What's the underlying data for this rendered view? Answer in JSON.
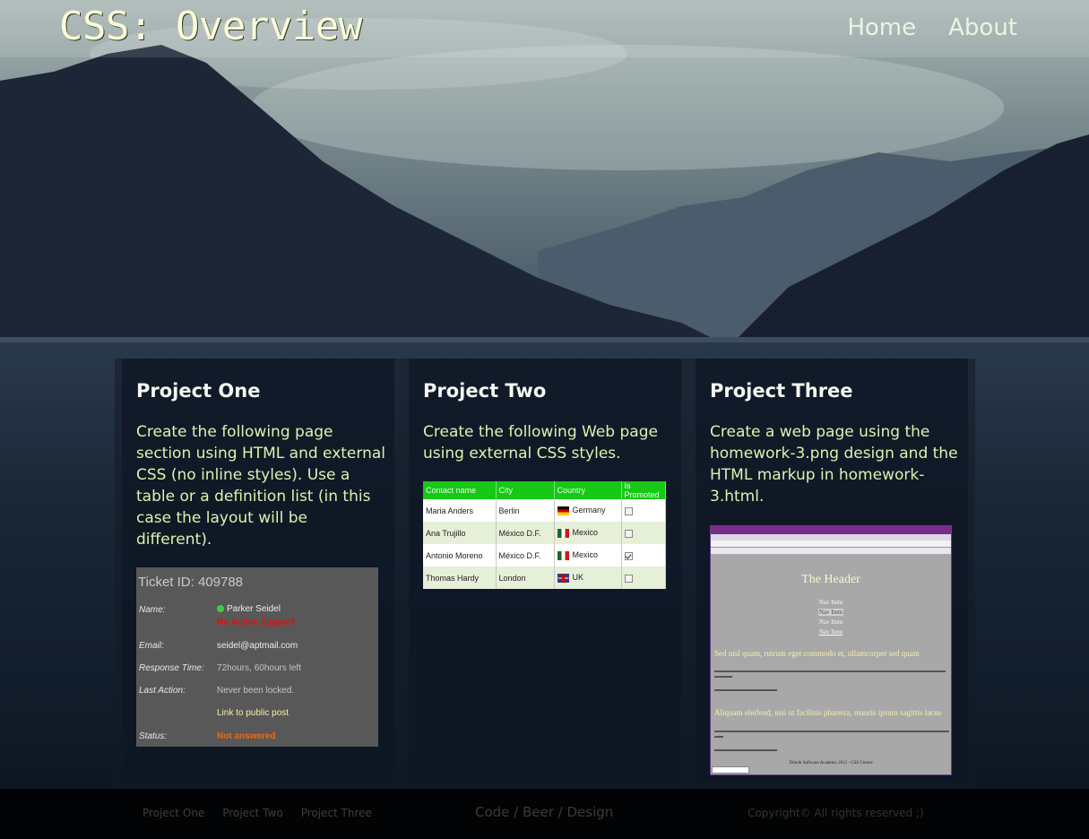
{
  "header": {
    "title": "CSS: Overview",
    "nav": [
      "Home",
      "About"
    ]
  },
  "projects": [
    {
      "title": "Project One",
      "description": "Create the following page section using HTML and external CSS (no inline styles). Use a table or a definition list (in this case the layout will be different)."
    },
    {
      "title": "Project Two",
      "description": "Create the following Web page using external CSS styles."
    },
    {
      "title": "Project Three",
      "description": "Create a web page using the homework-3.png design and the HTML markup in homework-3.html."
    }
  ],
  "ticket": {
    "id_text": "Ticket ID: 409788",
    "name_label": "Name:",
    "name_value": "Parker Seidel",
    "support_status": "No Active Support",
    "email_label": "Email:",
    "email_value": "seidel@aptmail.com",
    "response_label": "Response Time:",
    "response_value": "72hours, 60hours left",
    "last_action_label": "Last Action:",
    "last_action_value": "Never been locked.",
    "post_link": "Link to public post",
    "status_label": "Status:",
    "status_value": "Not answered"
  },
  "contacts_table": {
    "headers": [
      "Contact name",
      "City",
      "Country",
      "Is Promoted"
    ],
    "rows": [
      {
        "name": "Maria Anders",
        "city": "Berlin",
        "country": "Germany",
        "flag": "de",
        "promoted": false
      },
      {
        "name": "Ana Trujillo",
        "city": "México D.F.",
        "country": "Mexico",
        "flag": "mx",
        "promoted": false
      },
      {
        "name": "Antonio Moreno",
        "city": "México D.F.",
        "country": "Mexico",
        "flag": "mx",
        "promoted": true
      },
      {
        "name": "Thomas Hardy",
        "city": "London",
        "country": "UK",
        "flag": "uk",
        "promoted": false
      }
    ]
  },
  "homework_preview": {
    "header": "The Header",
    "nav_items": [
      "Nav Item",
      "Nav Item",
      "Nav Item",
      "Nav Item"
    ],
    "heading_1": "Sed nisl quam, rutrum eget commodo et, ullamcorper sed quam",
    "heading_2": "Aliquam eleifend, nisi ut facilisis pharetra, mauris ipsum sagittis lacus",
    "footer": "Telerik Software Academy 2012 - CSS Course"
  },
  "footer": {
    "links": [
      "Project One",
      "Project Two",
      "Project Three"
    ],
    "slogan": "Code / Beer / Design",
    "copyright": "Copyright© All rights reserved ;)"
  },
  "colors": {
    "title": "#fbfbd6",
    "body_text": "#d6f5b0",
    "table_header": "#17c817",
    "footer_bg": "#020304"
  }
}
